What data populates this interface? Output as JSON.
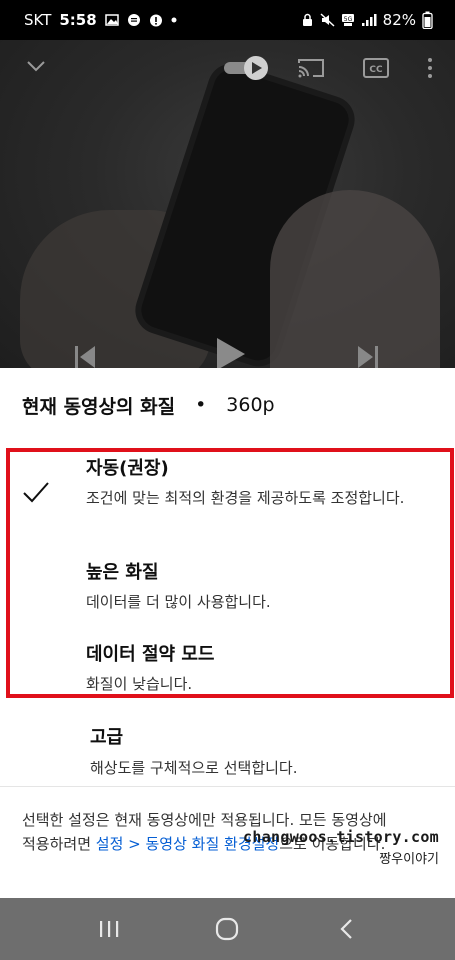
{
  "status_bar": {
    "carrier": "SKT",
    "time": "5:58",
    "battery": "82%"
  },
  "quality_sheet": {
    "header_title": "현재 동영상의 화질",
    "header_separator": "•",
    "current_resolution": "360p",
    "options": [
      {
        "title": "자동(권장)",
        "description": "조건에 맞는 최적의 환경을 제공하도록 조정합니다.",
        "selected": true
      },
      {
        "title": "높은 화질",
        "description": "데이터를 더 많이 사용합니다.",
        "selected": false
      },
      {
        "title": "데이터 절약 모드",
        "description": "화질이 낮습니다.",
        "selected": false
      }
    ],
    "advanced": {
      "title": "고급",
      "description": "해상도를 구체적으로 선택합니다."
    },
    "footer": {
      "text_before": "선택한 설정은 현재 동영상에만 적용됩니다. 모든 동영상에 적용하려면 ",
      "link": "설정 > 동영상 화질 환경설정",
      "text_after": "으로 이동합니다."
    },
    "highlight_color": "#e0101a",
    "link_color": "#065fd4"
  },
  "watermark": {
    "line1": "changwoos.tistory.com",
    "line2": "짱우이야기"
  },
  "icons": {
    "check": "checkmark-icon",
    "collapse": "chevron-down-icon",
    "autoplay": "autoplay-toggle-icon",
    "cast": "cast-icon",
    "captions": "cc-icon",
    "more": "more-vert-icon"
  }
}
